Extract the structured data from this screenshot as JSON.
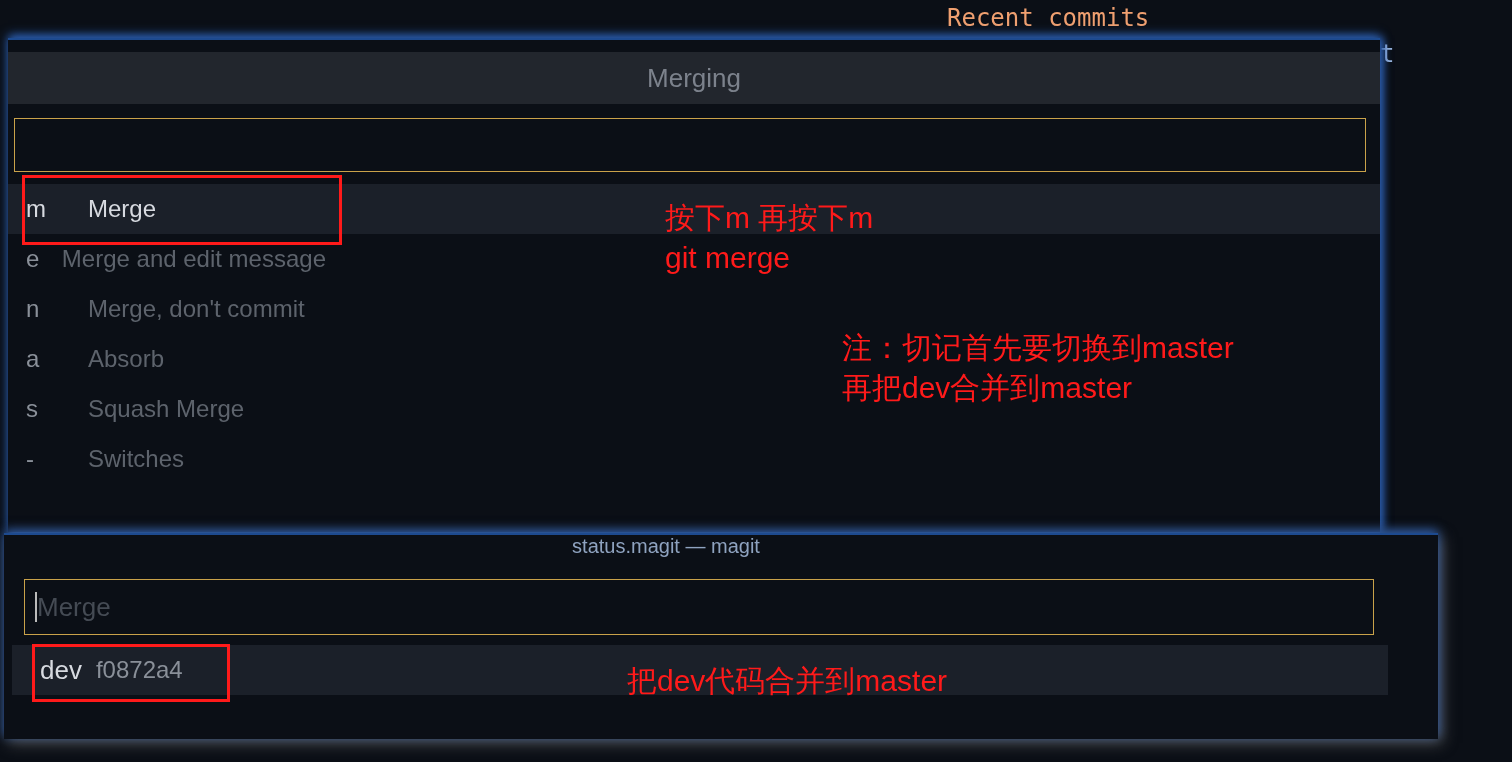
{
  "editor": {
    "heading": "Recent commits",
    "fragment": "t"
  },
  "merge_menu": {
    "title": "Merging",
    "items": [
      {
        "key": "m",
        "label": "Merge",
        "selected": true,
        "highlighted": true
      },
      {
        "key": "e",
        "label": "Merge and edit message",
        "selected": false,
        "highlighted": false
      },
      {
        "key": "n",
        "label": "Merge, don't commit",
        "selected": false,
        "highlighted": false
      },
      {
        "key": "a",
        "label": "Absorb",
        "selected": false,
        "highlighted": false
      },
      {
        "key": "s",
        "label": "Squash Merge",
        "selected": false,
        "highlighted": false
      },
      {
        "key": "-",
        "label": "Switches",
        "selected": false,
        "highlighted": false
      }
    ]
  },
  "branch_picker": {
    "title": "status.magit — magit",
    "search": {
      "placeholder": "Merge"
    },
    "items": [
      {
        "name": "dev",
        "hash": "f0872a4",
        "selected": true,
        "highlighted": true
      }
    ]
  },
  "notes": [
    {
      "lines": [
        "按下m 再按下m",
        "git merge"
      ]
    },
    {
      "lines": [
        "注：切记首先要切换到master",
        "再把dev合并到master"
      ]
    },
    {
      "lines": [
        "把dev代码合并到master"
      ]
    }
  ]
}
